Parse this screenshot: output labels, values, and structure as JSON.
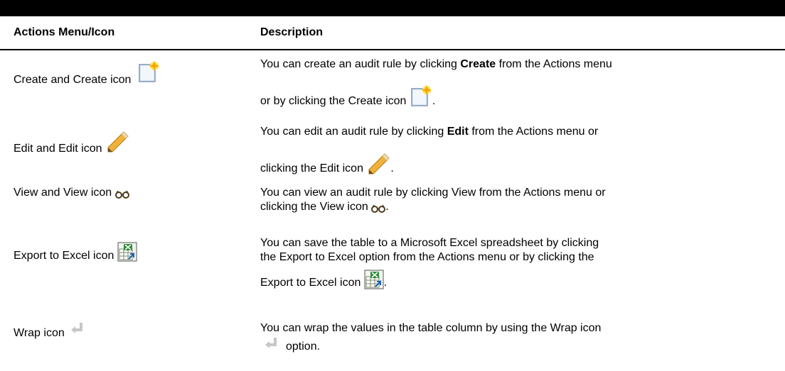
{
  "table": {
    "headers": {
      "col1": "Actions Menu/Icon",
      "col2": "Description"
    },
    "rows": [
      {
        "action": "Create and Create icon",
        "desc_line1_prefix": "You can create an audit rule by clicking ",
        "desc_line1_bold": "Create",
        "desc_line1_suffix": " from the Actions menu",
        "desc_line2_prefix": "or by clicking the Create icon",
        "desc_line2_suffix": "."
      },
      {
        "action": "Edit and Edit icon",
        "desc_line1_prefix": "You can edit an audit rule by clicking ",
        "desc_line1_bold": "Edit",
        "desc_line1_suffix": " from the Actions menu or",
        "desc_line2_prefix": "clicking the Edit icon",
        "desc_line2_suffix": "."
      },
      {
        "action": "View and View icon",
        "desc_line1": "You can view an audit rule by clicking View from the Actions menu or",
        "desc_line2_prefix": "clicking the View icon",
        "desc_line2_suffix": "."
      },
      {
        "action": "Export to Excel icon",
        "desc_line1": "You can save the table to a Microsoft Excel spreadsheet by clicking",
        "desc_line2": "the Export to Excel option from the Actions menu or by clicking the",
        "desc_line3_prefix": "Export to Excel icon",
        "desc_line3_suffix": "."
      },
      {
        "action": "Wrap icon",
        "desc_line1": "You can wrap the values in the table column by using the Wrap icon",
        "desc_line2_suffix": "option."
      }
    ]
  },
  "icons": {
    "create": "create-icon",
    "edit": "pencil-icon",
    "view": "glasses-icon",
    "excel": "excel-export-icon",
    "wrap": "wrap-icon"
  }
}
